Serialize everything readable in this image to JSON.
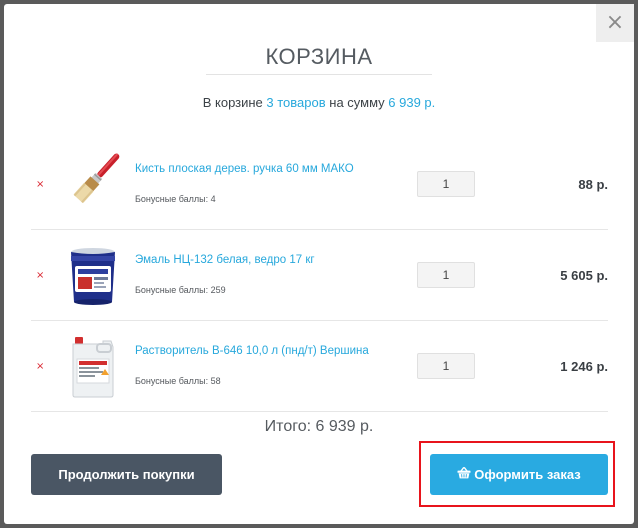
{
  "modal": {
    "close_label": "×",
    "title": "КОРЗИНА",
    "summary": {
      "prefix": "В корзине ",
      "count": "3 товаров",
      "middle": " на сумму ",
      "amount": "6 939 р."
    },
    "items": [
      {
        "remove": "×",
        "name": "Кисть плоская дерев. ручка 60 мм МАКО",
        "bonus": "Бонусные баллы: 4",
        "qty": "1",
        "price": "88 р."
      },
      {
        "remove": "×",
        "name": "Эмаль НЦ-132 белая, ведро 17 кг",
        "bonus": "Бонусные баллы: 259",
        "qty": "1",
        "price": "5 605 р."
      },
      {
        "remove": "×",
        "name": "Растворитель В-646 10,0 л (пнд/т) Вершина",
        "bonus": "Бонусные баллы: 58",
        "qty": "1",
        "price": "1 246 р."
      }
    ],
    "total": "Итого: 6 939 р.",
    "continue_button": "Продолжить покупки",
    "order_button": "Оформить заказ"
  },
  "icons": {
    "close": "close-icon",
    "remove": "remove-icon",
    "basket": "basket-icon"
  },
  "colors": {
    "accent": "#27a8dc",
    "order_button": "#29aae1",
    "continue_button": "#4a5664",
    "highlight": "#e8141c",
    "remove": "#d9232e"
  }
}
